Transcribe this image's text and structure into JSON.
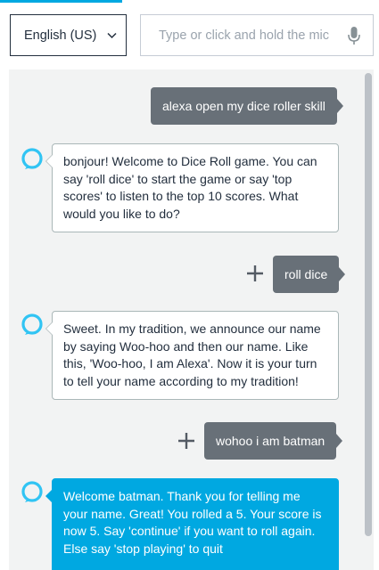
{
  "language_select": {
    "selected": "English (US)"
  },
  "utterance_input": {
    "placeholder": "Type or click and hold the mic"
  },
  "icons": {
    "dropdown": "chevron-down-icon",
    "mic": "microphone-icon",
    "alexa": "alexa-ring-icon",
    "add": "plus-icon"
  },
  "colors": {
    "accent": "#00a8e1",
    "user_bubble": "#687078",
    "panel_bg": "#f2f3f3",
    "text": "#232f3e"
  },
  "conversation": [
    {
      "speaker": "user",
      "text": "alexa open my dice roller skill"
    },
    {
      "speaker": "alexa",
      "text": "bonjour! Welcome to Dice Roll game. You can say 'roll dice' to start the game or say 'top scores' to listen to the top 10 scores. What would you like to do?"
    },
    {
      "speaker": "user",
      "text": "roll dice"
    },
    {
      "speaker": "alexa",
      "text": "Sweet. In my tradition, we announce our name by saying Woo-hoo and then our name. Like this, 'Woo-hoo, I am Alexa'. Now it is your turn to tell your name according to my tradition!"
    },
    {
      "speaker": "user",
      "text": "wohoo i am batman"
    },
    {
      "speaker": "alexa",
      "text": "Welcome batman. Thank you for telling me your name. Great! You rolled a 5. Your score is now 5. Say 'continue' if you want to roll again. Else say 'stop playing' to quit"
    }
  ]
}
